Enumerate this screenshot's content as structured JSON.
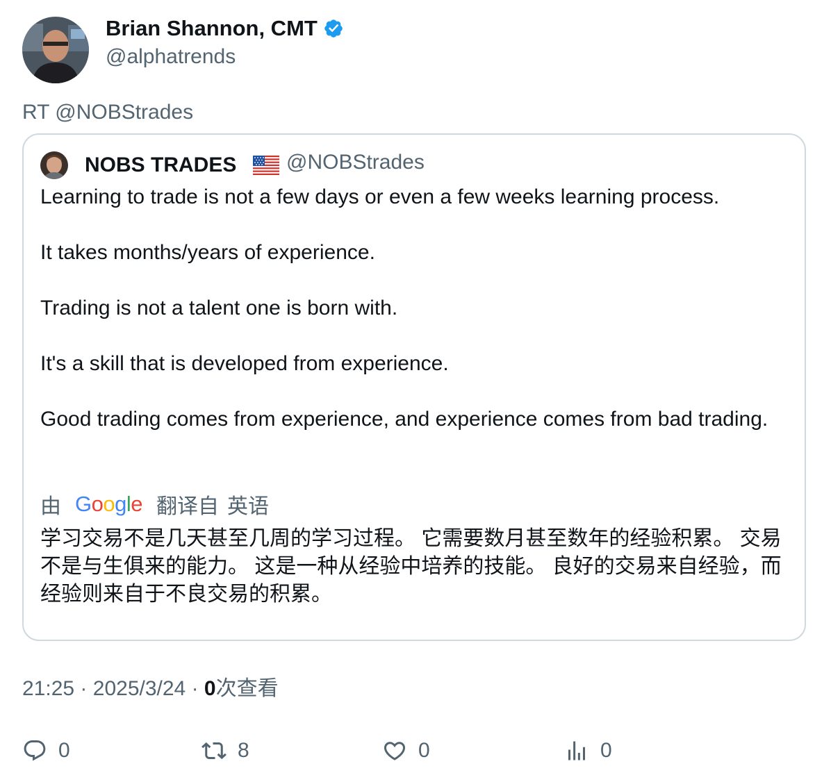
{
  "author": {
    "name": "Brian Shannon, CMT",
    "handle": "@alphatrends",
    "verified": true
  },
  "retweet_prefix": "RT @NOBStrades",
  "quoted": {
    "name": "NOBS TRADES",
    "flag": "us-flag-icon",
    "handle": "@NOBStrades",
    "paragraphs": [
      "Learning to trade is not a few days or even a few weeks learning process.",
      "It takes months/years of experience.",
      "Trading is not a talent one is born with.",
      "It's a skill that is developed from experience.",
      "Good trading comes from experience, and experience comes from bad trading."
    ],
    "translation": {
      "prefix": "由",
      "google": "Google",
      "translated_from": "翻译自",
      "language": "英语",
      "text": "学习交易不是几天甚至几周的学习过程。 它需要数月甚至数年的经验积累。 交易不是与生俱来的能力。 这是一种从经验中培养的技能。 良好的交易来自经验，而经验则来自于不良交易的积累。"
    }
  },
  "meta": {
    "time": "21:25",
    "separator": "·",
    "date": "2025/3/24",
    "views_count": "0",
    "views_label": "次查看"
  },
  "actions": {
    "replies": "0",
    "retweets": "8",
    "likes": "0",
    "views": "0"
  },
  "colors": {
    "text": "#0f1419",
    "secondary": "#536471",
    "border": "#cfd9de",
    "verified": "#1d9bf0"
  }
}
